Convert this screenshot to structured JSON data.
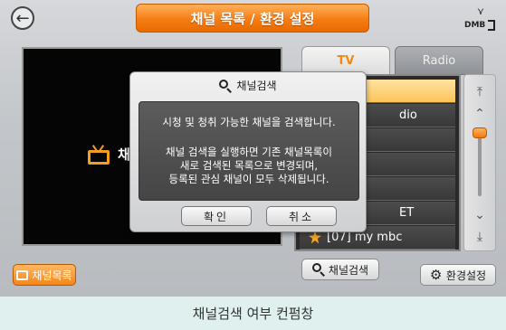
{
  "header": {
    "title": "채널 목록 / 환경 설정",
    "dmb_label": "DMB"
  },
  "video": {
    "channel_name": "채"
  },
  "tabs": [
    {
      "label": "TV",
      "active": true
    },
    {
      "label": "Radio",
      "active": false
    }
  ],
  "channel_list": {
    "rows": [
      {
        "text": "",
        "selected": true
      },
      {
        "text": "dio",
        "selected": false
      },
      {
        "text": "",
        "selected": false
      },
      {
        "text": "",
        "selected": false
      },
      {
        "text": "",
        "selected": false
      },
      {
        "text": "ET",
        "selected": false
      },
      {
        "text": "[07] my mbc",
        "selected": false,
        "favorite": true
      }
    ]
  },
  "buttons": {
    "channel_list": "채널목록",
    "channel_search": "채널검색",
    "settings": "환경설정"
  },
  "dialog": {
    "title": "채널검색",
    "message_line1": "시청 및 청취 가능한 채널을 검색합니다.",
    "message_line2a": "채널 검색을 실행하면 기존 채널목록이",
    "message_line2b": "새로 검색된 목록으로 변경되며,",
    "message_line2c": "등록된 관심 채널이 모두 삭제됩니다.",
    "ok": "확인",
    "cancel": "취소"
  },
  "caption": "채널검색 여부 컨펌창",
  "colors": {
    "accent_orange": "#f57d14",
    "selected_row": "#fbc45a",
    "caption_bg": "#dff0ee"
  }
}
